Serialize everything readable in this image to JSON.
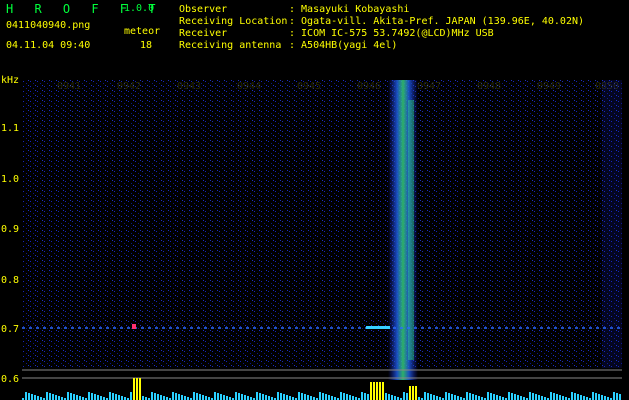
{
  "header": {
    "app_title": "H R O F F T",
    "version": "1.0.0",
    "filename": "0411040940.png",
    "timestamp": "04.11.04 09:40",
    "meteor_label": "meteor",
    "meteor_count": "18",
    "info": [
      {
        "label": "Observer",
        "value": ": Masayuki Kobayashi"
      },
      {
        "label": "Receiving Location",
        "value": ": Ogata-vill. Akita-Pref. JAPAN (139.96E, 40.02N)"
      },
      {
        "label": "Receiver",
        "value": ": ICOM IC-575 53.7492(@LCD)MHz USB"
      },
      {
        "label": "Receiving antenna",
        "value": ": A504HB(yagi 4el)"
      }
    ]
  },
  "axis": {
    "y_unit": "kHz",
    "y_ticks": [
      "1.1",
      "1.0",
      "0.9",
      "0.8",
      "0.7",
      "0.6"
    ],
    "x_ticks": [
      "0941",
      "0942",
      "0943",
      "0944",
      "0945",
      "0946",
      "0947",
      "0948",
      "0949",
      "0850"
    ]
  },
  "colors": {
    "background": "#000000",
    "label": "#ffff00",
    "title": "#00ff3c",
    "noise": "#1a2bd8"
  }
}
